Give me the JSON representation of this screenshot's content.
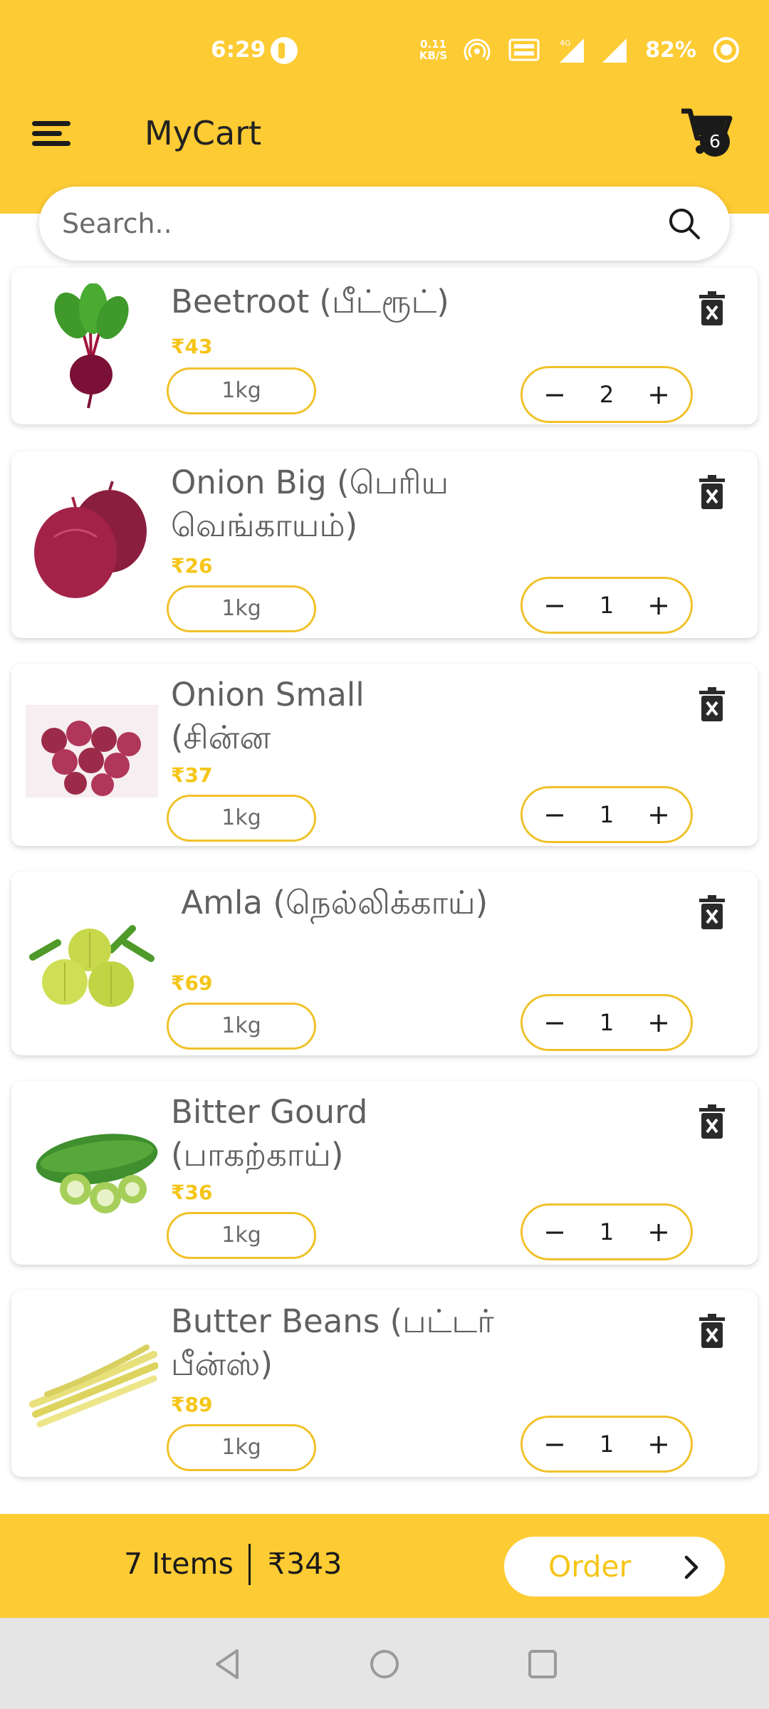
{
  "status_bar": {
    "time": "6:29",
    "net_speed_value": "0.11",
    "net_speed_unit": "KB/S",
    "network_label": "4G",
    "battery": "82%"
  },
  "app_bar": {
    "title": "MyCart",
    "cart_badge_count": "6"
  },
  "search": {
    "placeholder": "Search.."
  },
  "cart_items": [
    {
      "name": "Beetroot (பீட்ரூட்)",
      "price": "₹43",
      "weight": "1kg",
      "quantity": "2",
      "image": "beetroot-image"
    },
    {
      "name": "Onion Big (பெரிய வெங்காயம்)",
      "price": "₹26",
      "weight": "1kg",
      "quantity": "1",
      "image": "red-onion-image"
    },
    {
      "name": "Onion Small (சின்ன",
      "price": "₹37",
      "weight": "1kg",
      "quantity": "1",
      "image": "small-onions-image"
    },
    {
      "name": " Amla (நெல்லிக்காய்)",
      "price": "₹69",
      "weight": "1kg",
      "quantity": "1",
      "image": "amla-image"
    },
    {
      "name": "Bitter Gourd (பாகற்காய்)",
      "price": "₹36",
      "weight": "1kg",
      "quantity": "1",
      "image": "bitter-gourd-image"
    },
    {
      "name": "Butter Beans (பட்டர் பீன்ஸ்)",
      "price": "₹89",
      "weight": "1kg",
      "quantity": "1",
      "image": "butter-beans-image"
    }
  ],
  "stepper_symbols": {
    "minus": "−",
    "plus": "+"
  },
  "order_bar": {
    "items_count": "7 Items",
    "total": "₹343",
    "order_label": "Order"
  },
  "colors": {
    "accent": "#fdcb33",
    "price_text": "#f5c518",
    "nav_background": "#e5e5e5"
  },
  "icons": [
    "menu-icon",
    "cart-icon",
    "search-icon",
    "delete-icon",
    "chevron-right-icon",
    "back-icon",
    "home-icon",
    "recents-icon"
  ]
}
